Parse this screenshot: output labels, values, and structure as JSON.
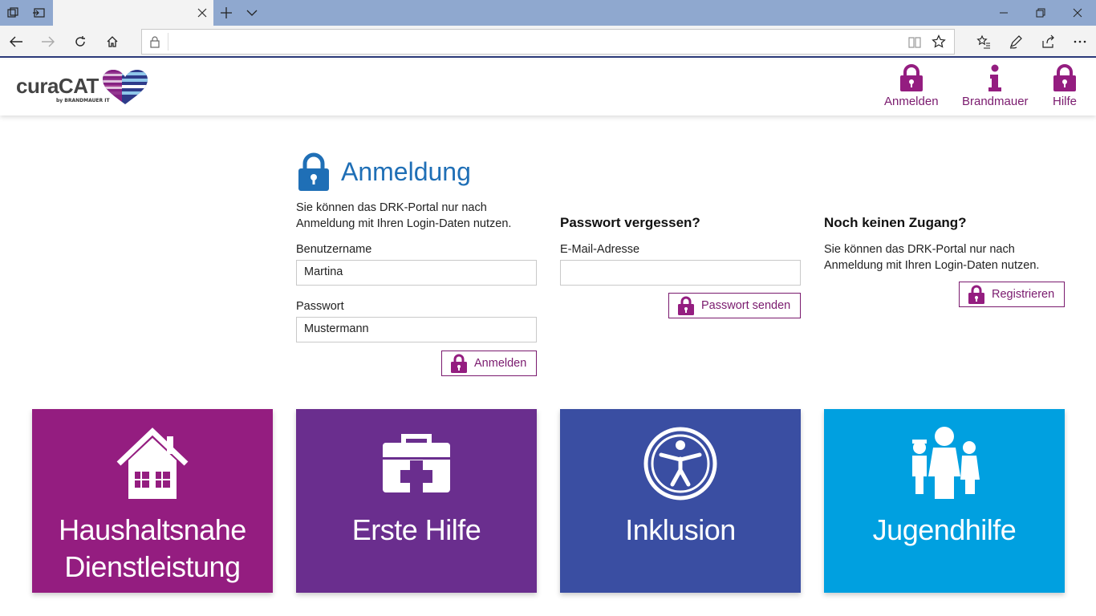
{
  "browser": {
    "address_text": "",
    "tab_title": ""
  },
  "header": {
    "logo_text": "curaCAT",
    "logo_sub": "by BRANDMAUER IT",
    "nav": [
      {
        "label": "Anmelden",
        "icon": "lock-icon"
      },
      {
        "label": "Brandmauer",
        "icon": "info-icon"
      },
      {
        "label": "Hilfe",
        "icon": "lock-icon"
      }
    ],
    "accent_color": "#7a1a6e"
  },
  "login": {
    "title": "Anmeldung",
    "intro_line1": "Sie können das DRK-Portal nur nach",
    "intro_line2": "Anmeldung mit Ihren Login-Daten nutzen.",
    "username_label": "Benutzername",
    "username_value": "Martina",
    "password_label": "Passwort",
    "password_value": "Mustermann",
    "submit_label": "Anmelden",
    "title_color": "#1f6fb6"
  },
  "forgot": {
    "heading": "Passwort vergessen?",
    "email_label": "E-Mail-Adresse",
    "email_value": "",
    "submit_label": "Passwort senden"
  },
  "register": {
    "heading": "Noch keinen Zugang?",
    "text_line1": "Sie können das DRK-Portal nur nach",
    "text_line2": "Anmeldung mit Ihren Login-Daten nutzen.",
    "submit_label": "Registrieren"
  },
  "tiles": [
    {
      "line1": "Haushaltsnahe",
      "line2": "Dienstleistung",
      "color": "#941d80",
      "icon": "house-icon"
    },
    {
      "line1": "Erste Hilfe",
      "line2": "",
      "color": "#6a2e8e",
      "icon": "first-aid-kit-icon"
    },
    {
      "line1": "Inklusion",
      "line2": "",
      "color": "#3a4ea2",
      "icon": "accessibility-icon"
    },
    {
      "line1": "Jugendhilfe",
      "line2": "",
      "color": "#00a0e0",
      "icon": "family-icon"
    }
  ]
}
